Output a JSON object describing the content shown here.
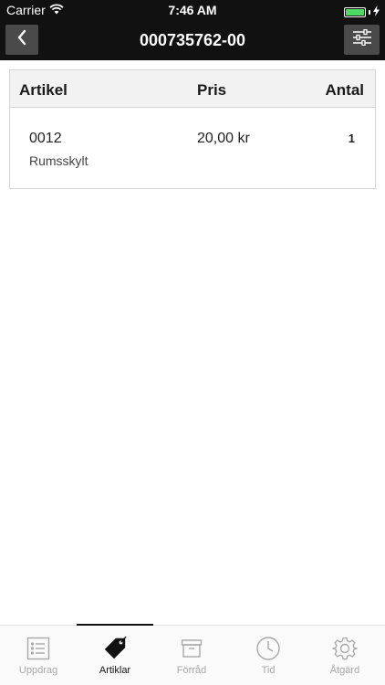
{
  "status_bar": {
    "carrier": "Carrier",
    "time": "7:46 AM"
  },
  "nav": {
    "title": "000735762-00"
  },
  "table": {
    "columns": [
      "Artikel",
      "Pris",
      "Antal"
    ],
    "rows": [
      {
        "code": "0012",
        "name": "Rumsskylt",
        "price": "20,00 kr",
        "quantity": "1"
      }
    ]
  },
  "tabbar": {
    "active_tab": "Artiklar",
    "tabs": [
      {
        "label": "Uppdrag",
        "icon": "list-icon"
      },
      {
        "label": "Artiklar",
        "icon": "tag-icon"
      },
      {
        "label": "Förråd",
        "icon": "archive-box-icon"
      },
      {
        "label": "Tid",
        "icon": "clock-icon"
      },
      {
        "label": "Åtgärd",
        "icon": "gear-icon"
      }
    ]
  },
  "colors": {
    "nav_background": "#111111",
    "nav_button": "#4a4a4a",
    "header_background": "#f2f2f2",
    "battery": "#4cd964",
    "tab_inactive": "#a8a8a8",
    "tab_active": "#111111"
  }
}
